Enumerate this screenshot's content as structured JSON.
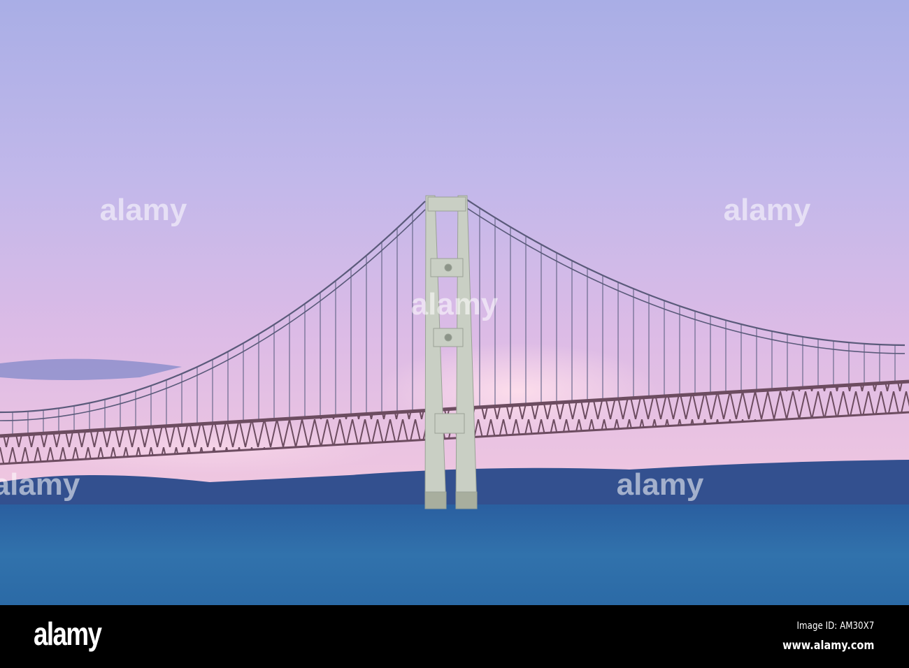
{
  "watermark": {
    "logo": "alamy",
    "image_id": "Image ID: AM30X7",
    "url": "www.alamy.com"
  },
  "colors": {
    "sky_top": "#aab0e8",
    "sky_mid": "#d6b8e6",
    "sky_low": "#f0c4dc",
    "water": "#2f6aa6",
    "shore": "#2c4a8c",
    "tower": "#c9cfc4",
    "truss": "#7a5a6a"
  }
}
